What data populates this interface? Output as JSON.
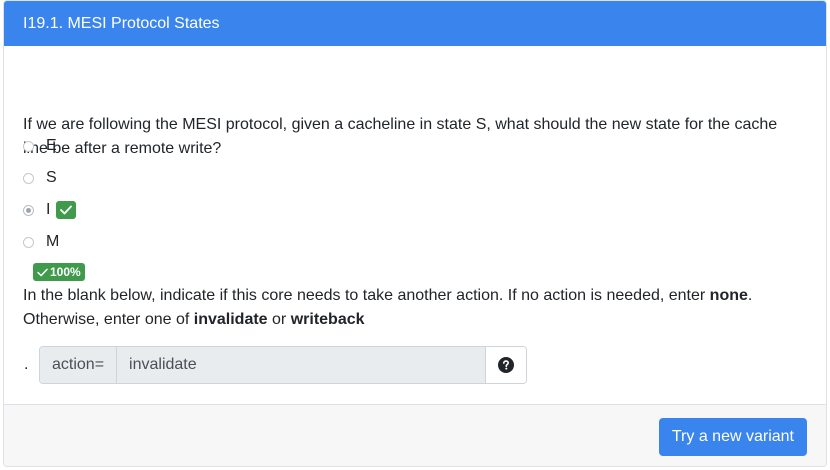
{
  "header": {
    "title": "I19.1. MESI Protocol States"
  },
  "question": {
    "text": "If we are following the MESI protocol, given a cacheline in state S, what should the new state for the cache line be after a remote write?"
  },
  "options": [
    {
      "label": "E",
      "selected": false
    },
    {
      "label": "S",
      "selected": false
    },
    {
      "label": "I",
      "selected": true,
      "correct": true
    },
    {
      "label": "M",
      "selected": false
    }
  ],
  "score": {
    "text": "100%"
  },
  "instructions": {
    "part1": "In the blank below, indicate if this core needs to take another action. If no action is needed, enter ",
    "none": "none",
    "part2": ". Otherwise, enter one of ",
    "invalidate": "invalidate",
    "or": " or ",
    "writeback": "writeback"
  },
  "answer": {
    "prefix": ".",
    "addon": "action=",
    "value": "invalidate"
  },
  "footer": {
    "button_label": "Try a new variant"
  },
  "colors": {
    "primary": "#3a84ee",
    "success": "#3f9b4b"
  }
}
